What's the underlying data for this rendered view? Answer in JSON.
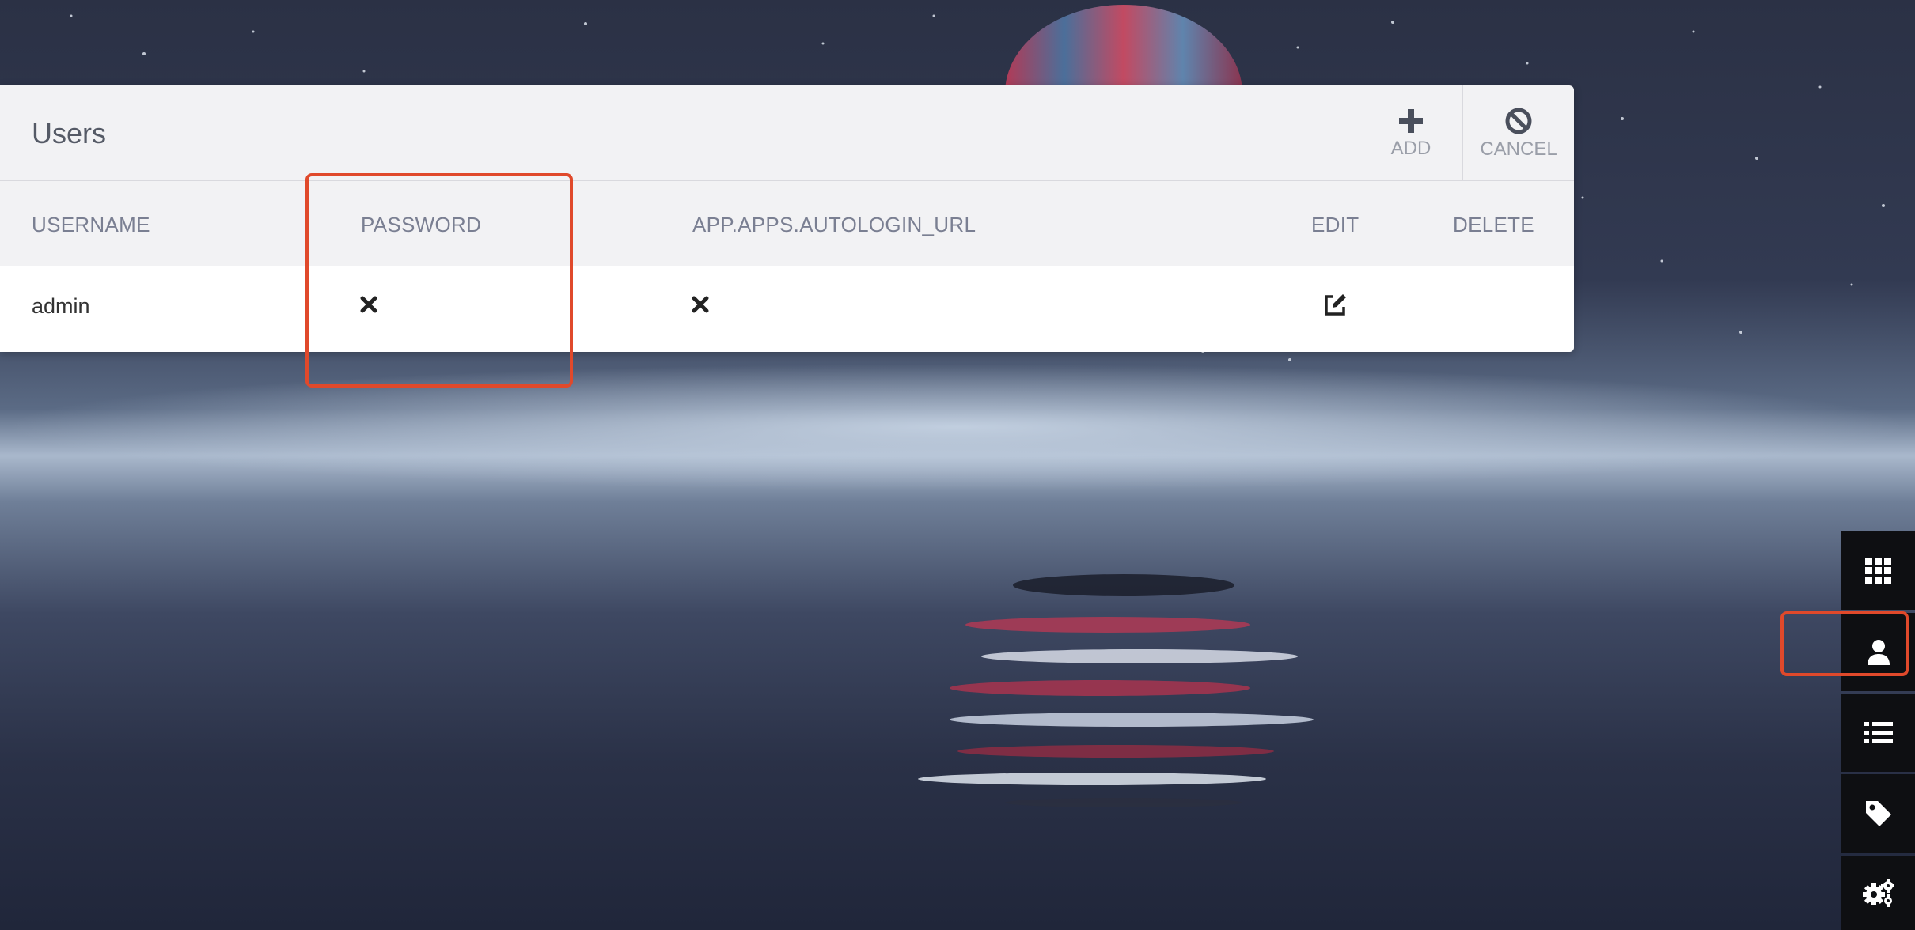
{
  "panel": {
    "title": "Users",
    "actions": {
      "add_label": "ADD",
      "cancel_label": "CANCEL"
    }
  },
  "table": {
    "columns": [
      "USERNAME",
      "PASSWORD",
      "APP.APPS.AUTOLOGIN_URL",
      "EDIT",
      "DELETE"
    ],
    "rows": [
      {
        "username": "admin",
        "password": "x-icon",
        "autologin_url": "x-icon",
        "edit": "edit-icon",
        "delete": ""
      }
    ]
  },
  "sidebar": {
    "items": [
      {
        "icon": "grid-icon"
      },
      {
        "icon": "user-icon",
        "active": true
      },
      {
        "icon": "list-icon"
      },
      {
        "icon": "tag-icon"
      },
      {
        "icon": "gears-icon"
      }
    ]
  },
  "colors": {
    "highlight": "#e0492b",
    "sidebar_bg": "#0e0f12",
    "panel_bg": "#f2f2f4"
  }
}
